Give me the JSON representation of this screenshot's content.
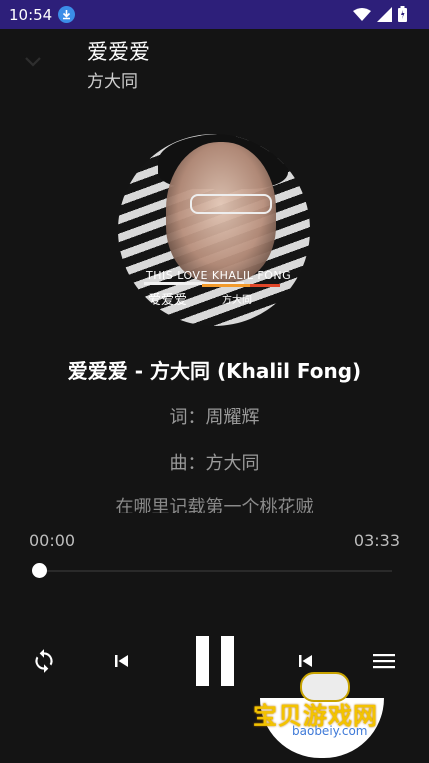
{
  "status": {
    "time": "10:54",
    "icons": [
      "download-icon",
      "wifi-icon",
      "signal-icon",
      "battery-icon"
    ]
  },
  "header": {
    "title": "爱爱爱",
    "artist": "方大同"
  },
  "album_cover": {
    "text_en": "THIS LOVE KHALIL FONG",
    "text_cn": "爱爱爱",
    "text_cn2": "方大同"
  },
  "song": {
    "full_title": "爱爱爱 - 方大同 (Khalil Fong)"
  },
  "lyrics": {
    "line1": "词：周耀辉",
    "line2": "曲：方大同",
    "line3": "在哪里记载第一个桃花贼"
  },
  "progress": {
    "current": "00:00",
    "total": "03:33",
    "fraction": 0
  },
  "controls": {
    "repeat": "repeat-icon",
    "previous": "skip-previous-icon",
    "pause": "pause-icon",
    "next": "skip-previous-icon",
    "playlist": "playlist-icon"
  },
  "watermark": {
    "title": "宝贝游戏网",
    "url": "baobeiy.com"
  },
  "colors": {
    "statusbar": "#2d1f7a",
    "background": "#141414",
    "accent_orange": "#f29a2b"
  }
}
